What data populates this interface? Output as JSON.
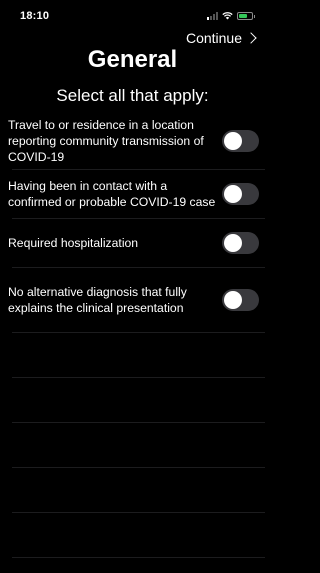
{
  "status_bar": {
    "time": "18:10",
    "icons": [
      "signal-icon",
      "wifi-icon",
      "battery-charging-icon"
    ],
    "battery_color": "#34c759",
    "battery_level": 0.7
  },
  "nav": {
    "continue_label": "Continue"
  },
  "header": {
    "title": "General",
    "subtitle": "Select all that apply:"
  },
  "options": [
    {
      "label": "Travel to or residence in a location reporting community transmission of COVID-19",
      "checked": false
    },
    {
      "label": "Having been in contact with a confirmed or probable COVID-19 case",
      "checked": false
    },
    {
      "label": "Required hospitalization",
      "checked": false
    },
    {
      "label": "No alternative diagnosis that fully explains the clinical presentation",
      "checked": false
    }
  ],
  "colors": {
    "background": "#000000",
    "toggle_off": "#39393d",
    "separator": "#1c1c1e"
  }
}
